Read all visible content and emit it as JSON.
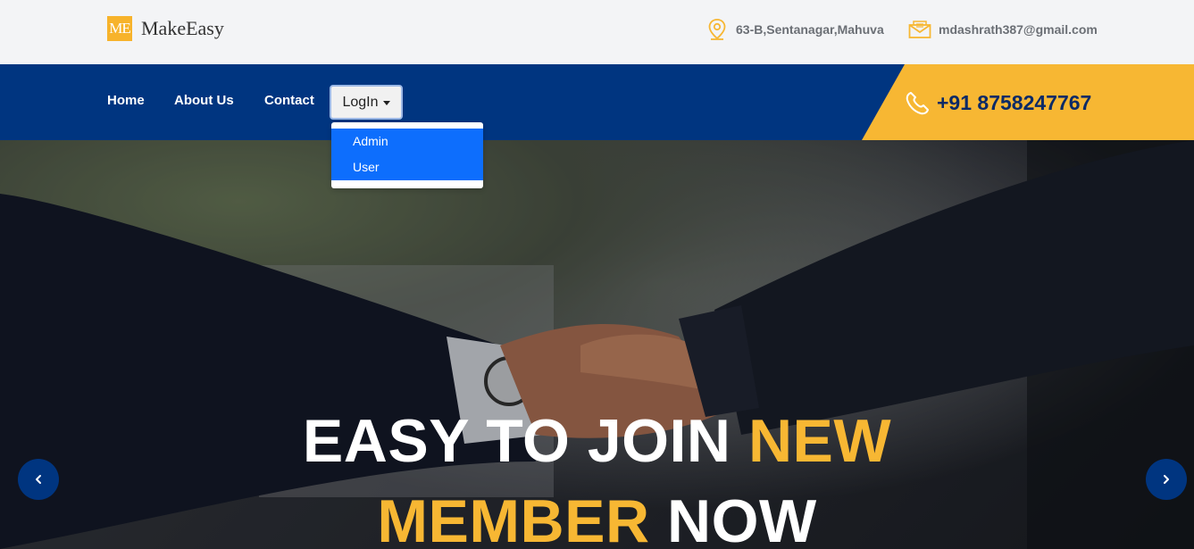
{
  "brand": {
    "logo_mark": "ME",
    "name": "MakeEasy"
  },
  "contact": {
    "address": "63-B,Sentanagar,Mahuva",
    "email": "mdashrath387@gmail.com",
    "phone": "+91 8758247767"
  },
  "nav": {
    "items": [
      {
        "label": "Home"
      },
      {
        "label": "About Us"
      },
      {
        "label": "Contact"
      }
    ],
    "login_label": "LogIn",
    "login_menu": [
      {
        "label": "Admin"
      },
      {
        "label": "User"
      }
    ]
  },
  "hero": {
    "line1_white": "EASY TO JOIN",
    "line1_accent": "NEW",
    "line2_accent": "MEMBER",
    "line2_white": "NOW"
  },
  "colors": {
    "navy": "#003580",
    "accent": "#f7b733",
    "dropdown_active": "#0d6efd"
  },
  "icons": {
    "address": "map-pin-icon",
    "email": "envelope-icon",
    "phone": "phone-icon",
    "prev": "chevron-left-icon",
    "next": "chevron-right-icon"
  }
}
